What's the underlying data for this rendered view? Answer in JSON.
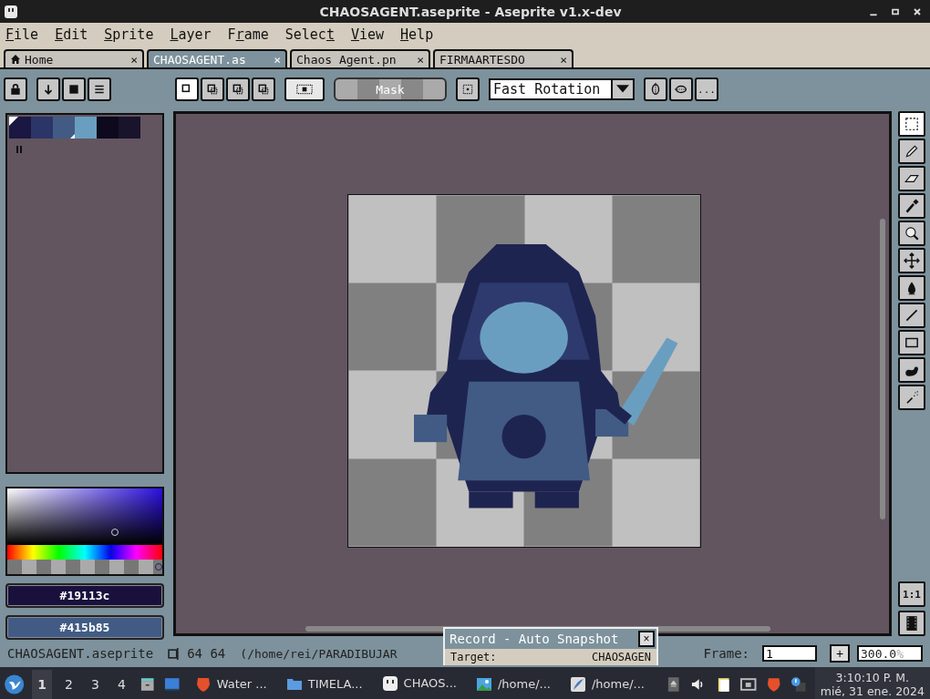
{
  "window": {
    "title": "CHAOSAGENT.aseprite - Aseprite v1.x-dev"
  },
  "menu": [
    {
      "key": "F",
      "post": "ile"
    },
    {
      "key": "E",
      "post": "dit"
    },
    {
      "key": "S",
      "post": "prite"
    },
    {
      "key": "L",
      "post": "ayer"
    },
    {
      "pre": "F",
      "key": "r",
      "post": "ame"
    },
    {
      "pre": "Selec",
      "key": "t"
    },
    {
      "key": "V",
      "post": "iew"
    },
    {
      "key": "H",
      "post": "elp"
    }
  ],
  "tabs": [
    {
      "label": "Home",
      "kind": "home",
      "close": "×",
      "selected": false
    },
    {
      "label": "CHAOSAGENT.as",
      "kind": "file",
      "close": "×",
      "selected": true
    },
    {
      "label": "Chaos Agent.pn",
      "kind": "file",
      "close": "×",
      "selected": false
    },
    {
      "label": "FIRMAARTESDO",
      "kind": "file",
      "close": "×",
      "selected": false
    }
  ],
  "toolbar": {
    "selection_modes": [
      {
        "selected": true
      },
      {
        "selected": false
      },
      {
        "selected": false
      },
      {
        "selected": false
      }
    ],
    "mask_label": "Mask",
    "rotation": "Fast Rotation",
    "more": "..."
  },
  "palette": [
    {
      "color": "#1a1742",
      "fg": true,
      "bg": false
    },
    {
      "color": "#2c3568",
      "fg": false,
      "bg": false
    },
    {
      "color": "#415b85",
      "fg": false,
      "bg": true
    },
    {
      "color": "#6a9ec0",
      "fg": false,
      "bg": false
    },
    {
      "color": "#0c0a1c",
      "fg": false,
      "bg": false
    },
    {
      "color": "#19132c",
      "fg": false,
      "bg": false
    }
  ],
  "hue": {
    "level": 0.67
  },
  "alpha": {
    "level": 1
  },
  "colors": {
    "foreground": "#19113c",
    "background": "#415b85"
  },
  "tools": [
    {
      "kind": "select",
      "selected": true
    },
    {
      "kind": "pencil",
      "selected": false
    },
    {
      "kind": "eraser",
      "selected": false
    },
    {
      "kind": "eyedropper",
      "selected": false
    },
    {
      "kind": "zoom",
      "selected": false
    },
    {
      "kind": "move",
      "selected": false
    },
    {
      "kind": "bucket",
      "selected": false
    },
    {
      "kind": "line",
      "selected": false
    },
    {
      "kind": "rectangle",
      "selected": false
    },
    {
      "kind": "blob",
      "selected": false
    },
    {
      "kind": "spray",
      "selected": false
    }
  ],
  "zoom_reset": "1:1",
  "status_bar": {
    "file": "CHAOSAGENT.aseprite",
    "size": "64 64",
    "path": "(/home/rei/PARADIBUJAR",
    "frame_label": "Frame:",
    "frame": "1",
    "add": "+",
    "zoom": "300.0",
    "zoom_unit": "%"
  },
  "record_popup": {
    "title": "Record - Auto Snapshot",
    "close": "×",
    "target_label": "Target:",
    "target": "CHAOSAGEN"
  },
  "taskbar": {
    "workspaces": [
      {
        "label": "1",
        "selected": true
      },
      {
        "label": "2",
        "selected": false
      },
      {
        "label": "3",
        "selected": false
      },
      {
        "label": "4",
        "selected": false
      }
    ],
    "apps": [
      {
        "label": "Water ...",
        "kind": "browser",
        "selected": false
      },
      {
        "label": "TIMELA...",
        "kind": "folder",
        "selected": false
      },
      {
        "label": "CHAOS...",
        "kind": "aseprite",
        "selected": true
      },
      {
        "label": "/home/...",
        "kind": "image",
        "selected": false
      },
      {
        "label": "/home/...",
        "kind": "feather",
        "selected": false
      }
    ],
    "clock_time": "3:10:10 P. M.",
    "clock_date": "mié, 31 ene. 2024"
  }
}
